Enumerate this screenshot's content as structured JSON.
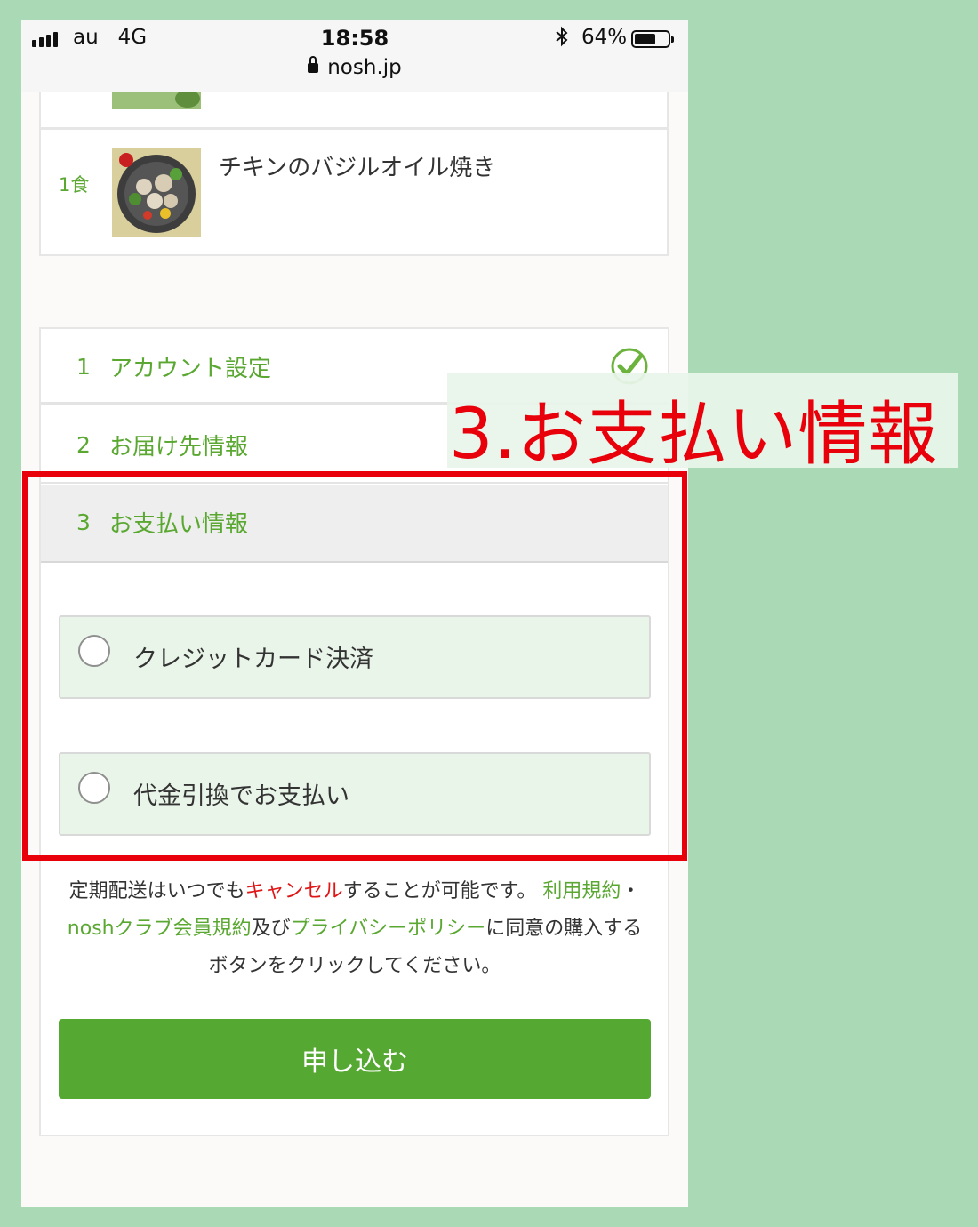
{
  "status_bar": {
    "carrier": "au",
    "network": "4G",
    "time": "18:58",
    "url": "nosh.jp",
    "battery": "64%",
    "battery_level": 0.64
  },
  "meals": [
    {
      "quantity": "1食",
      "name": "チキンのバジルオイル焼き"
    }
  ],
  "steps": [
    {
      "number": "1",
      "label": "アカウント設定",
      "completed": true
    },
    {
      "number": "2",
      "label": "お届け先情報",
      "completed": true
    },
    {
      "number": "3",
      "label": "お支払い情報",
      "completed": false
    }
  ],
  "payment_options": [
    {
      "label": "クレジットカード決済",
      "selected": false
    },
    {
      "label": "代金引換でお支払い",
      "selected": false
    }
  ],
  "note": {
    "part1": "定期配送はいつでも",
    "cancel": "キャンセル",
    "part2": "することが可能です。 ",
    "terms": "利用規約",
    "sep": "・",
    "club_terms": "noshクラブ会員規約",
    "and": "及び",
    "privacy": "プライバシーポリシー",
    "part3": "に同意の購入するボタンをクリックしてください。"
  },
  "submit_label": "申し込む",
  "annotation": {
    "label": "3.お支払い情報",
    "color": "#e8000a"
  },
  "colors": {
    "accent_green": "#5aa832",
    "button_green": "#55a832",
    "background": "#aadab5"
  }
}
